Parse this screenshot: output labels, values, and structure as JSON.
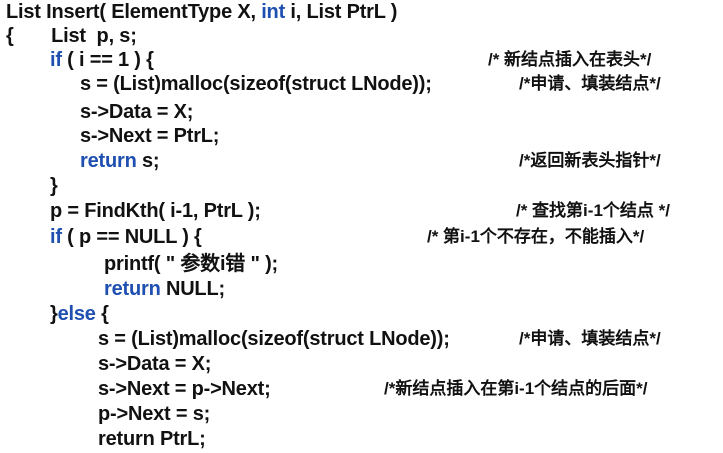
{
  "code": {
    "l1": {
      "t1": "List Insert( ElementType X, ",
      "kw": "int",
      "t2": " i, List PtrL )"
    },
    "l2": {
      "t1": "{       List  p, s;"
    },
    "l3": {
      "kw": "if",
      "t2": " ( i == 1 ) {",
      "comment": "/* 新结点插入在表头*/"
    },
    "l4": {
      "t1": "s = (List)malloc(sizeof(struct LNode));",
      "comment": "/*申请、填装结点*/"
    },
    "l5": {
      "t1": "s->Data = X;"
    },
    "l6": {
      "t1": "s->Next = PtrL;"
    },
    "l7": {
      "kw": "return",
      "t2": " s;",
      "comment": "/*返回新表头指针*/"
    },
    "l8": {
      "t1": "}"
    },
    "l9": {
      "t1": "p = FindKth( i-1, PtrL );",
      "comment": "/* 查找第i-1个结点 */"
    },
    "l10": {
      "kw": "if",
      "t2": " ( p == NULL ) {",
      "comment": "/* 第i-1个不存在，不能插入*/"
    },
    "l11": {
      "t1": "printf( \" 参数i错 \" );"
    },
    "l12": {
      "kw": "return",
      "t2": " NULL;"
    },
    "l13": {
      "t1": "}",
      "kw": "else",
      "t2": " {"
    },
    "l14": {
      "t1": "s = (List)malloc(sizeof(struct LNode));",
      "comment": "/*申请、填装结点*/"
    },
    "l15": {
      "t1": "s->Data = X;"
    },
    "l16": {
      "t1": "s->Next = p->Next;",
      "comment": "/*新结点插入在第i-1个结点的后面*/"
    },
    "l17": {
      "t1": "p->Next = s;"
    },
    "l18": {
      "t1": "return PtrL;"
    }
  }
}
